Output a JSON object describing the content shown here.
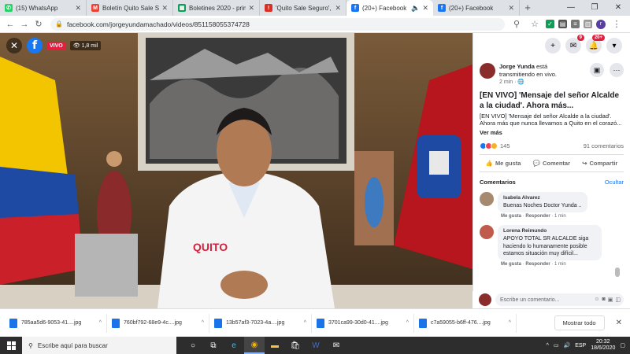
{
  "browser": {
    "tabs": [
      {
        "title": "(15) WhatsApp",
        "icon": "whatsapp-icon",
        "color": "#25d366",
        "glyph": "✆"
      },
      {
        "title": "Boletín Quito Sale Segu",
        "icon": "gmail-icon",
        "color": "#ea4335",
        "glyph": "M"
      },
      {
        "title": "Boletines 2020 - primer",
        "icon": "sheets-icon",
        "color": "#0f9d58",
        "glyph": "▦"
      },
      {
        "title": "'Quito Sale Seguro', ge",
        "icon": "alert-icon",
        "color": "#d93025",
        "glyph": "!"
      },
      {
        "title": "(20+) Facebook",
        "icon": "facebook-icon",
        "color": "#1877f2",
        "glyph": "f"
      },
      {
        "title": "(20+) Facebook",
        "icon": "facebook-icon",
        "color": "#1877f2",
        "glyph": "f"
      }
    ],
    "url": "facebook.com/jorgeyundamachado/videos/851158055374728"
  },
  "video": {
    "live_label": "VIVO",
    "views": "1,8 mil",
    "logo_text": "QUITO"
  },
  "post": {
    "author": "Jorge Yunda",
    "status": "está transmitiendo en vivo.",
    "time": "2 min",
    "title": "[EN VIVO] 'Mensaje del señor Alcalde a la ciudad'. Ahora más...",
    "body": "[EN VIVO] 'Mensaje del señor Alcalde a la ciudad'. Ahora más que nunca llevamos a Quito en el corazó...",
    "see_more": "Ver más",
    "reactions_count": "145",
    "comments_count": "91 comentarios",
    "actions": {
      "like": "Me gusta",
      "comment": "Comentar",
      "share": "Compartir"
    },
    "comments_header": "Comentarios",
    "hide_label": "Ocultar",
    "write_placeholder": "Escribe un comentario...",
    "notif_badges": {
      "messenger": "9",
      "notifications": "20+"
    }
  },
  "comments": [
    {
      "name": "Isabela Alvarez",
      "text": "Buenas Noches Doctor Yunda ..",
      "like": "Me gusta",
      "reply": "Responder",
      "time": "1 min"
    },
    {
      "name": "Lorena Reimundo",
      "text": "APOYO TOTAL SR ALCALDE siga haciendo lo humanamente posible estamos situación muy difícil...",
      "like": "Me gusta",
      "reply": "Responder",
      "time": "1 min"
    }
  ],
  "downloads": {
    "files": [
      "785aa5d6-9053-41....jpg",
      "760bf792-68e9-4c....jpg",
      "13b57af3-7023-4a....jpg",
      "3701ca99-30d0-41....jpg",
      "c7a59055-b6ff-476....jpg"
    ],
    "show_all": "Mostrar todo"
  },
  "taskbar": {
    "search_placeholder": "Escribe aquí para buscar",
    "lang": "ESP",
    "time": "20:32",
    "date": "18/6/2020"
  }
}
